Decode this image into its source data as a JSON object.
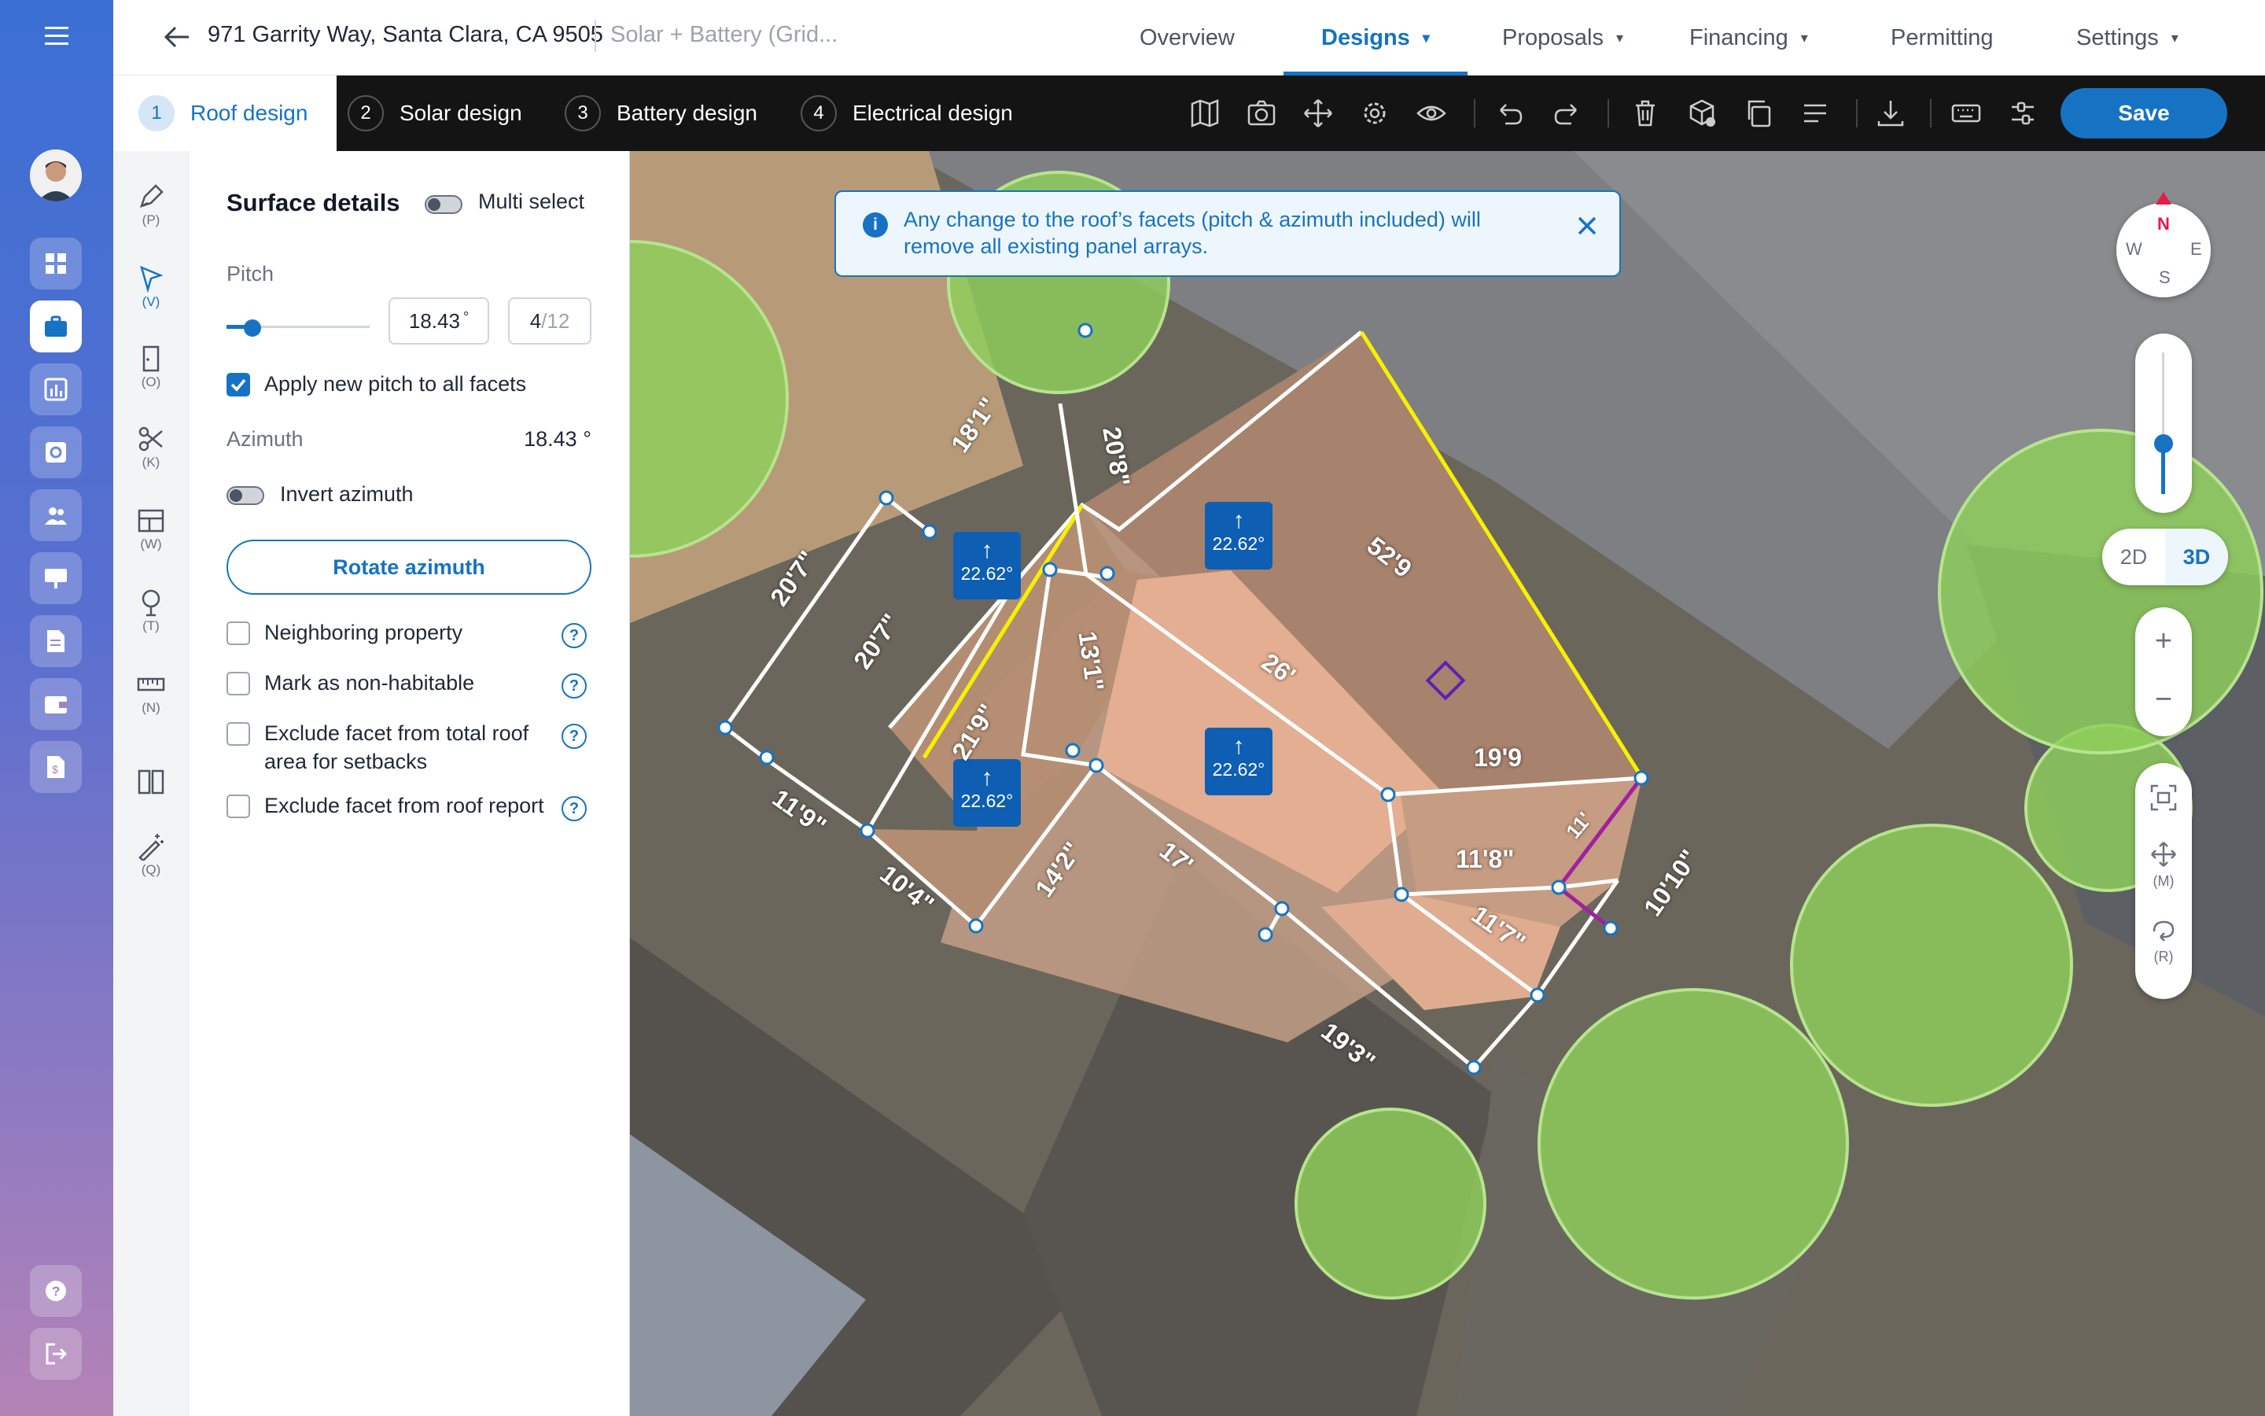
{
  "header": {
    "address": "971 Garrity Way, Santa Clara, CA 9505",
    "project_type": "Solar + Battery (Grid...",
    "nav": {
      "overview": "Overview",
      "designs": "Designs",
      "proposals": "Proposals",
      "financing": "Financing",
      "permitting": "Permitting",
      "settings": "Settings"
    }
  },
  "steps": [
    {
      "num": "1",
      "label": "Roof design"
    },
    {
      "num": "2",
      "label": "Solar design"
    },
    {
      "num": "3",
      "label": "Battery design"
    },
    {
      "num": "4",
      "label": "Electrical design"
    }
  ],
  "toolbar": {
    "save_label": "Save"
  },
  "tools": {
    "pen": "(P)",
    "select": "(V)",
    "obstruction": "(O)",
    "cut": "(K)",
    "window": "(W)",
    "tree": "(T)",
    "ruler": "(N)",
    "magic": "(Q)"
  },
  "panel": {
    "title": "Surface details",
    "multi_select": "Multi select",
    "pitch_label": "Pitch",
    "pitch_value": "18.43",
    "pitch_unit": "°",
    "pitch_ratio": "4",
    "pitch_ratio_den": "/12",
    "pitch_slider_fraction": 0.18,
    "apply_all": "Apply new pitch to all facets",
    "azimuth_label": "Azimuth",
    "azimuth_value": "18.43 °",
    "invert_azimuth": "Invert azimuth",
    "rotate_button": "Rotate azimuth",
    "checkboxes": [
      "Neighboring property",
      "Mark as non-habitable",
      "Exclude facet from total roof area for setbacks",
      "Exclude facet from roof report"
    ]
  },
  "map": {
    "banner": "Any change to the roof’s facets (pitch & azimuth included) will remove all existing panel arrays.",
    "facet_pitch": "22.62°",
    "measurements": [
      "18'1\"",
      "20'8\"",
      "52'9",
      "20'7\"",
      "20'7\"",
      "13'1\"",
      "26'",
      "21'9\"",
      "11'9\"",
      "10'4\"",
      "14'2\"",
      "17'",
      "19'9",
      "11'8\"",
      "11'",
      "11'7\"",
      "10'10\"",
      "19'3\""
    ],
    "compass": {
      "n": "N",
      "w": "W",
      "e": "E",
      "s": "S"
    },
    "view_2d": "2D",
    "view_3d": "3D",
    "zoom_in": "+",
    "zoom_out": "−",
    "move_key": "(M)",
    "rotate_key": "(R)"
  },
  "colors": {
    "brand_blue": "#1673c4",
    "tree_green": "#8fcf5a",
    "roof_line_yellow": "#f5f100"
  }
}
